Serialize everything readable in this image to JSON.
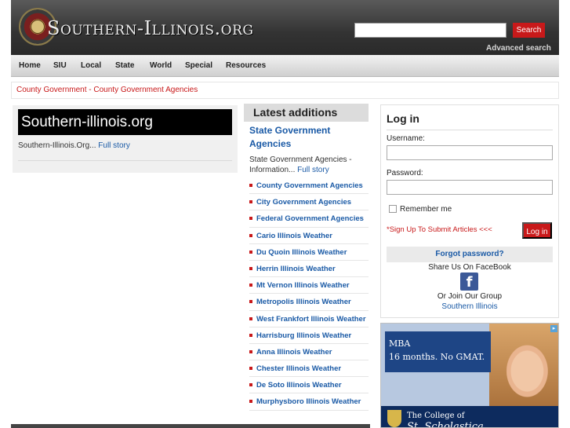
{
  "header": {
    "site_title": "Southern-Illinois.org",
    "search_placeholder": "",
    "search_button": "Search",
    "advanced_search": "Advanced search"
  },
  "nav": {
    "items": [
      "Home",
      "SIU",
      "Local",
      "State",
      "World",
      "Special",
      "Resources"
    ]
  },
  "breadcrumb": {
    "first": "County Government",
    "separator": " - ",
    "second": "County Government Agencies"
  },
  "left": {
    "title": "Southern-illinois.org",
    "text": "Southern-Illinois.Org...",
    "link": "Full story"
  },
  "latest": {
    "heading": "Latest additions",
    "feature_title": "State Government Agencies",
    "feature_text": "State Government Agencies - Information...",
    "feature_link": "Full story",
    "items": [
      "County Government Agencies",
      "City Government Agencies",
      "Federal Government Agencies",
      "Cario Illinois Weather",
      "Du Quoin Illinois Weather",
      "Herrin Illinois Weather",
      "Mt Vernon Illinois Weather",
      "Metropolis Illinois Weather",
      "West Frankfort Illinois Weather",
      "Harrisburg Illinois Weather",
      "Anna Illinois Weather",
      "Chester Illinois Weather",
      "De Soto Illinois Weather",
      "Murphysboro Illinois Weather"
    ]
  },
  "login": {
    "title": "Log in",
    "username_label": "Username:",
    "password_label": "Password:",
    "remember_label": "Remember me",
    "signup_text": "*Sign Up To Submit Articles <<<",
    "login_button": "Log in",
    "forgot_password": "Forgot password?",
    "share_text": "Share Us On FaceBook",
    "facebook_glyph": "f",
    "join_text": "Or Join Our Group",
    "group_link": "Southern Illinois"
  },
  "ad": {
    "line1": "MBA",
    "line2": "16 months. No GMAT.",
    "college_line1": "The College of",
    "college_line2": "St. Scholastica"
  },
  "colors": {
    "accent_red": "#c8191a",
    "link_blue": "#1a5aa6",
    "header_dark": "#333333",
    "facebook_blue": "#3b5998"
  }
}
